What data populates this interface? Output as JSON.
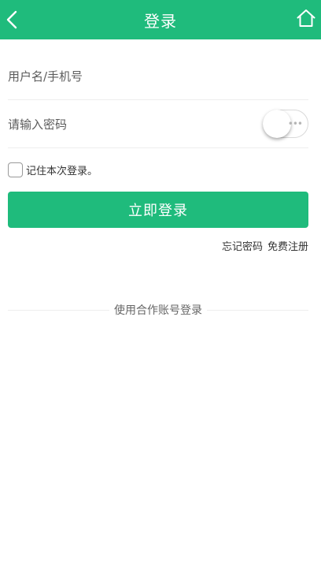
{
  "colors": {
    "accent": "#1fbb7c"
  },
  "header": {
    "title": "登录",
    "back_icon": "chevron-left-icon",
    "home_icon": "home-icon"
  },
  "form": {
    "username": {
      "placeholder": "用户名/手机号",
      "value": ""
    },
    "password": {
      "placeholder": "请输入密码",
      "value": "",
      "show_password_toggle": false
    },
    "remember": {
      "label": "记住本次登录。",
      "checked": false
    },
    "submit_label": "立即登录"
  },
  "links": {
    "forgot": "忘记密码",
    "register": "免费注册"
  },
  "partner_login": {
    "label": "使用合作账号登录"
  }
}
